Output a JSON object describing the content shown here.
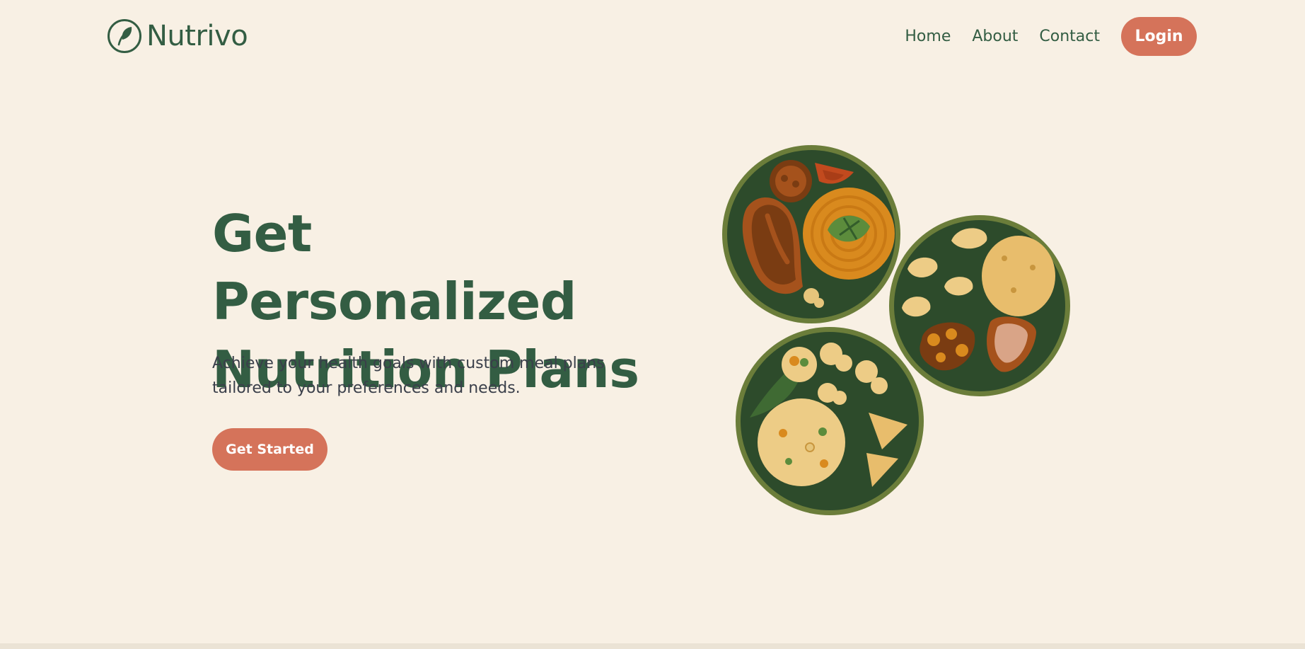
{
  "brand": {
    "name": "Nutrivo",
    "logo_icon": "leaf-circle-icon"
  },
  "nav": {
    "links": [
      "Home",
      "About",
      "Contact"
    ],
    "login_label": "Login"
  },
  "hero": {
    "title_line1": "Get Personalized",
    "title_line2": "Nutrition Plans",
    "subtitle_line1": "Achieve your health goals with custom meal plans",
    "subtitle_line2": "tailored to your preferences and needs.",
    "cta_label": "Get Started"
  },
  "colors": {
    "background": "#f8f0e4",
    "brand_green": "#335d43",
    "accent": "#d5735a",
    "plate_dark": "#2d4b2b",
    "plate_rim": "#6b7d3a"
  }
}
